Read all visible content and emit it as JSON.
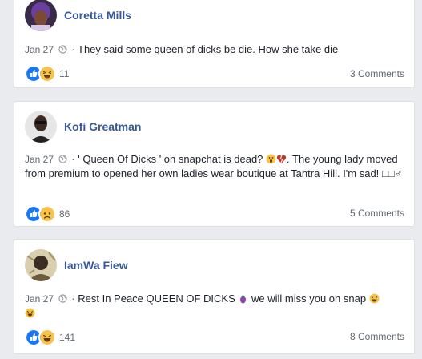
{
  "posts": [
    {
      "author": "Coretta Mills",
      "date": "Jan 27",
      "separator": "·",
      "text": "They said some queen of dicks be die. How she take die",
      "reaction_count": "11",
      "comments": "3 Comments",
      "reactions": [
        "like-icon",
        "haha-icon"
      ]
    },
    {
      "author": "Kofi Greatman",
      "date": "Jan 27",
      "separator": "·",
      "text_part1": "' Queen Of Dicks ' on snapchat is dead?",
      "text_part2": ". The young lady moved from premium to opened her own ladies wear boutique at Tantra Hill. I'm sad!",
      "text_tail": "□□♂",
      "reaction_count": "86",
      "comments": "5 Comments",
      "reactions": [
        "like-icon",
        "sad-icon"
      ]
    },
    {
      "author": "IamWa Fiew",
      "date": "Jan 27",
      "separator": "·",
      "text_part1": "Rest In Peace QUEEN OF DICKS",
      "text_part2": "we will miss you on snap",
      "reaction_count": "141",
      "comments": "8 Comments",
      "reactions": [
        "like-icon",
        "haha-icon"
      ]
    }
  ],
  "colors": {
    "name": "#385898",
    "like": "#1877f2",
    "emoji_yellow": "#f7c34b",
    "background": "#e9ebee"
  }
}
